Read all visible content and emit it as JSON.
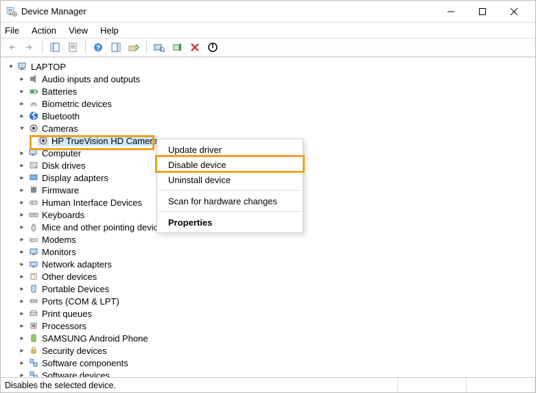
{
  "window": {
    "title": "Device Manager"
  },
  "menu": {
    "file": "File",
    "action": "Action",
    "view": "View",
    "help": "Help"
  },
  "tree": {
    "root": "LAPTOP",
    "items": [
      "Audio inputs and outputs",
      "Batteries",
      "Biometric devices",
      "Bluetooth",
      "Cameras",
      "Computer",
      "Disk drives",
      "Display adapters",
      "Firmware",
      "Human Interface Devices",
      "Keyboards",
      "Mice and other pointing devices",
      "Modems",
      "Monitors",
      "Network adapters",
      "Other devices",
      "Portable Devices",
      "Ports (COM & LPT)",
      "Print queues",
      "Processors",
      "SAMSUNG Android Phone",
      "Security devices",
      "Software components",
      "Software devices"
    ],
    "camera_child": "HP TrueVision HD Camera"
  },
  "context_menu": {
    "update": "Update driver",
    "disable": "Disable device",
    "uninstall": "Uninstall device",
    "scan": "Scan for hardware changes",
    "properties": "Properties"
  },
  "status": {
    "text": "Disables the selected device."
  },
  "colors": {
    "highlight": "#f0a020",
    "selection": "#cde8ff"
  }
}
